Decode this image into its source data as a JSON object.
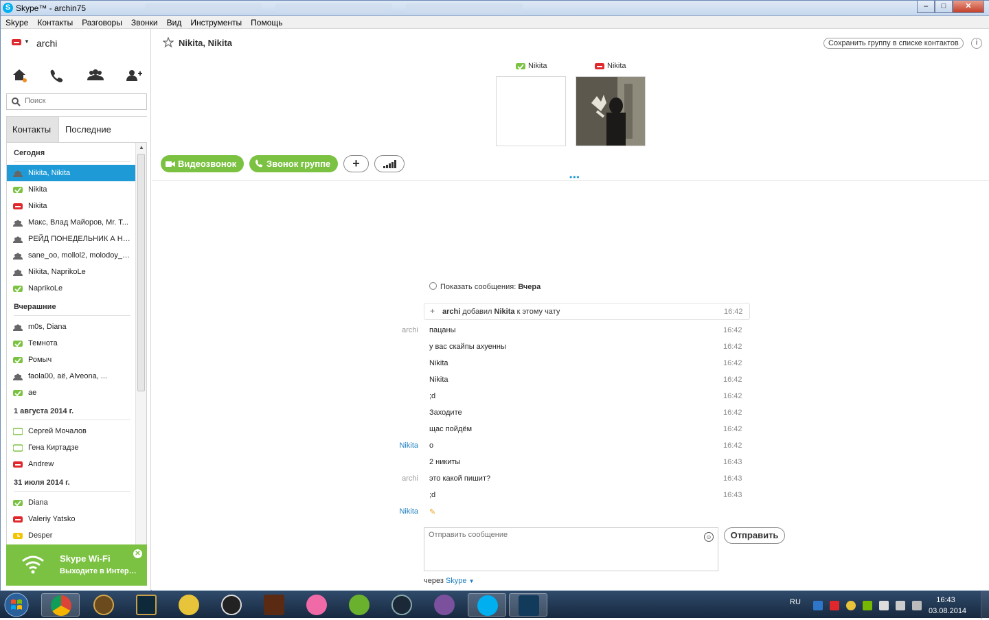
{
  "window": {
    "title": "Skype™ - archin75",
    "controls": [
      "–",
      "□",
      "✕"
    ]
  },
  "menu": [
    "Skype",
    "Контакты",
    "Разговоры",
    "Звонки",
    "Вид",
    "Инструменты",
    "Помощь"
  ],
  "profile": {
    "name": "archi",
    "status_color": "#e0272c"
  },
  "search": {
    "placeholder": "Поиск"
  },
  "tabs": {
    "contacts": "Контакты",
    "recent": "Последние"
  },
  "contact_groups": [
    {
      "header": "Сегодня",
      "items": [
        {
          "label": "Nikita, Nikita",
          "icon": "group-icon",
          "selected": true
        },
        {
          "label": "Nikita",
          "icon": "online-status-icon"
        },
        {
          "label": "Nikita",
          "icon": "dnd-status-icon"
        },
        {
          "label": "Макс, Влад Майоров, Mr. T...",
          "icon": "group-icon"
        },
        {
          "label": "РЕЙД ПОНЕДЕЛЬНИК А НЕ...",
          "icon": "group-icon"
        },
        {
          "label": "sane_oo, mollol2, molodoy_0...",
          "icon": "group-icon"
        },
        {
          "label": "Nikita, NaprikoLe",
          "icon": "group-icon"
        },
        {
          "label": "NaprikoLe",
          "icon": "online-status-icon"
        }
      ]
    },
    {
      "header": "Вчерашние",
      "items": [
        {
          "label": "m0s, Diana",
          "icon": "group-icon"
        },
        {
          "label": "Темнота",
          "icon": "online-status-icon"
        },
        {
          "label": "Ромыч",
          "icon": "online-status-icon"
        },
        {
          "label": "faola00, aë, Alveona, ...",
          "icon": "group-icon"
        },
        {
          "label": "ae",
          "icon": "online-status-icon"
        }
      ]
    },
    {
      "header": "1 августа 2014 г.",
      "items": [
        {
          "label": "Сергей Мочалов",
          "icon": "offline-status-icon"
        },
        {
          "label": "Гена Киртадзе",
          "icon": "offline-status-icon"
        },
        {
          "label": "Andrew",
          "icon": "dnd-status-icon"
        }
      ]
    },
    {
      "header": "31 июля 2014 г.",
      "items": [
        {
          "label": "Diana",
          "icon": "online-status-icon"
        },
        {
          "label": "Valeriy Yatsko",
          "icon": "dnd-status-icon"
        },
        {
          "label": "Desper",
          "icon": "away-status-icon"
        }
      ]
    }
  ],
  "promo": {
    "title": "Skype Wi-Fi",
    "subtitle": "Выходите в Интернет"
  },
  "conversation": {
    "title": "Nikita, Nikita",
    "save_group": "Сохранить группу в списке контактов",
    "info": "i",
    "participants": [
      {
        "name": "Nikita",
        "status": "online"
      },
      {
        "name": "Nikita",
        "status": "dnd"
      }
    ],
    "buttons": {
      "video": "Видеозвонок",
      "group_call": "Звонок группе",
      "add": "+"
    },
    "show_messages_label": "Показать сообщения:",
    "show_messages_value": "Вчера",
    "event": {
      "actor": "archi",
      "verb": "добавил",
      "target": "Nikita",
      "rest": "к этому чату",
      "time": "16:42"
    },
    "messages": [
      {
        "author": "archi",
        "text": "пацаны",
        "time": "16:42"
      },
      {
        "author": "",
        "text": "у вас скайпы ахуенны",
        "time": "16:42"
      },
      {
        "author": "",
        "text": "Nikita",
        "time": "16:42"
      },
      {
        "author": "",
        "text": "Nikita",
        "time": "16:42"
      },
      {
        "author": "",
        "text": ";d",
        "time": "16:42"
      },
      {
        "author": "",
        "text": "Заходите",
        "time": "16:42"
      },
      {
        "author": "",
        "text": "щас пойдём",
        "time": "16:42"
      },
      {
        "author": "Nikita",
        "text": "о",
        "time": "16:42"
      },
      {
        "author": "",
        "text": "2 никиты",
        "time": "16:43"
      },
      {
        "author": "archi",
        "text": "это какой пишит?",
        "time": "16:43"
      },
      {
        "author": "",
        "text": ";d",
        "time": "16:43"
      },
      {
        "author": "Nikita",
        "text": "",
        "time": ""
      }
    ],
    "compose_placeholder": "Отправить сообщение",
    "send": "Отправить",
    "via_prefix": "через",
    "via_service": "Skype"
  },
  "taskbar": {
    "lang": "RU",
    "time": "16:43",
    "date": "03.08.2014"
  },
  "colors": {
    "accent": "#1e9bd7",
    "green": "#7cc242",
    "red": "#e0272c"
  }
}
